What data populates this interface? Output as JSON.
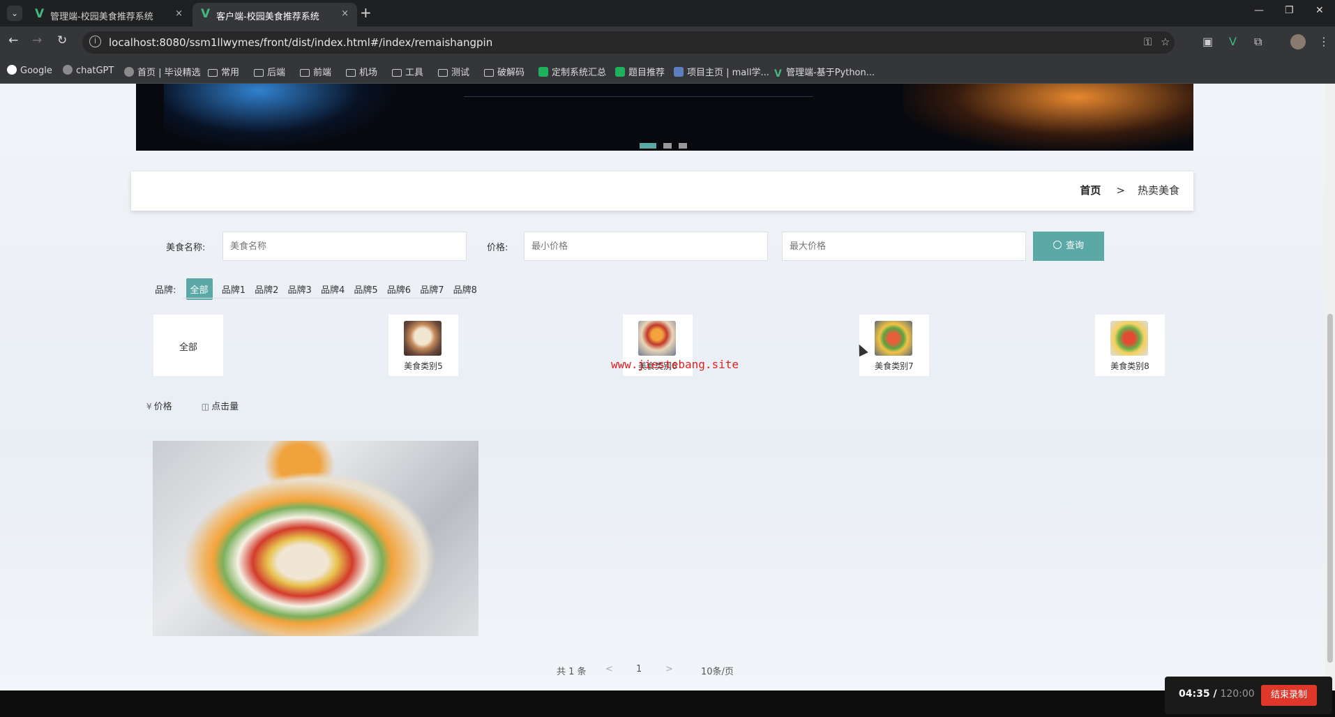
{
  "browser": {
    "tabs": [
      {
        "title": "管理端-校园美食推荐系统",
        "close": "×"
      },
      {
        "title": "客户端-校园美食推荐系统",
        "close": "×"
      }
    ],
    "new_tab": "+",
    "url": "localhost:8080/ssm1llwymes/front/dist/index.html#/index/remaishangpin",
    "bookmarks": [
      "Google",
      "chatGPT",
      "首页 | 毕设精选",
      "常用",
      "后端",
      "前端",
      "机场",
      "工具",
      "测试",
      "破解码",
      "定制系统汇总",
      "题目推荐",
      "项目主页 | mall学...",
      "管理端-基于Python..."
    ]
  },
  "breadcrumb": {
    "home": "首页",
    "sep": ">",
    "current": "热卖美食"
  },
  "search": {
    "name_label": "美食名称:",
    "name_placeholder": "美食名称",
    "price_label": "价格:",
    "min_placeholder": "最小价格",
    "max_placeholder": "最大价格",
    "button": "查询"
  },
  "brands": {
    "label": "品牌:",
    "items": [
      "全部",
      "品牌1",
      "品牌2",
      "品牌3",
      "品牌4",
      "品牌5",
      "品牌6",
      "品牌7",
      "品牌8"
    ]
  },
  "categories": [
    {
      "name": "全部"
    },
    {
      "name": "美食类别5"
    },
    {
      "name": "美食类别6"
    },
    {
      "name": "美食类别7"
    },
    {
      "name": "美食类别8"
    }
  ],
  "watermark": "www.jiestebang.site",
  "sort": {
    "price": "价格",
    "clicks": "点击量",
    "price_icon": "¥",
    "clicks_icon": "◫"
  },
  "pagination": {
    "total": "共 1 条",
    "prev": "<",
    "page": "1",
    "next": ">",
    "size": "10条/页"
  },
  "recorder": {
    "elapsed": "04:35 /",
    "total": "120:00",
    "stop": "结束录制"
  },
  "colors": {
    "accent": "#5aa9a7",
    "record": "#e0372b"
  }
}
